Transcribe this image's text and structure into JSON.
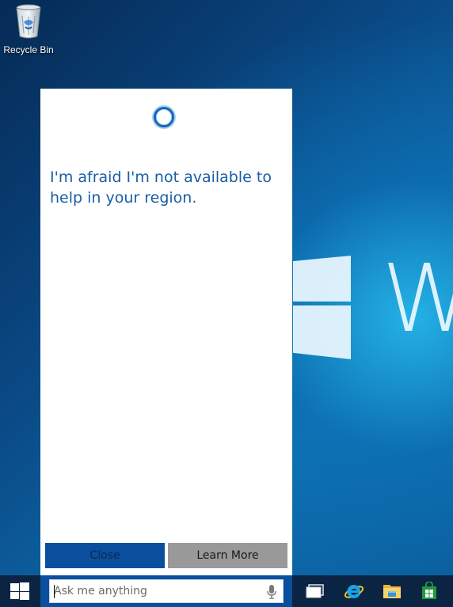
{
  "desktop": {
    "wallpaper_text": "W",
    "recycle_bin_label": "Recycle Bin"
  },
  "cortana": {
    "icon": "cortana-ring-icon",
    "message": "I'm afraid I'm not available to help in your region.",
    "buttons": {
      "close_label": "Close",
      "learn_more_label": "Learn More"
    }
  },
  "taskbar": {
    "search_placeholder": "Ask me anything",
    "search_value": "",
    "pinned": [
      "task-view-icon",
      "internet-explorer-icon",
      "file-explorer-icon",
      "store-icon"
    ]
  },
  "colors": {
    "accent": "#0a4f9d",
    "message_text": "#1a5ea6",
    "taskbar": "#0b2443",
    "secondary_button": "#999999"
  }
}
